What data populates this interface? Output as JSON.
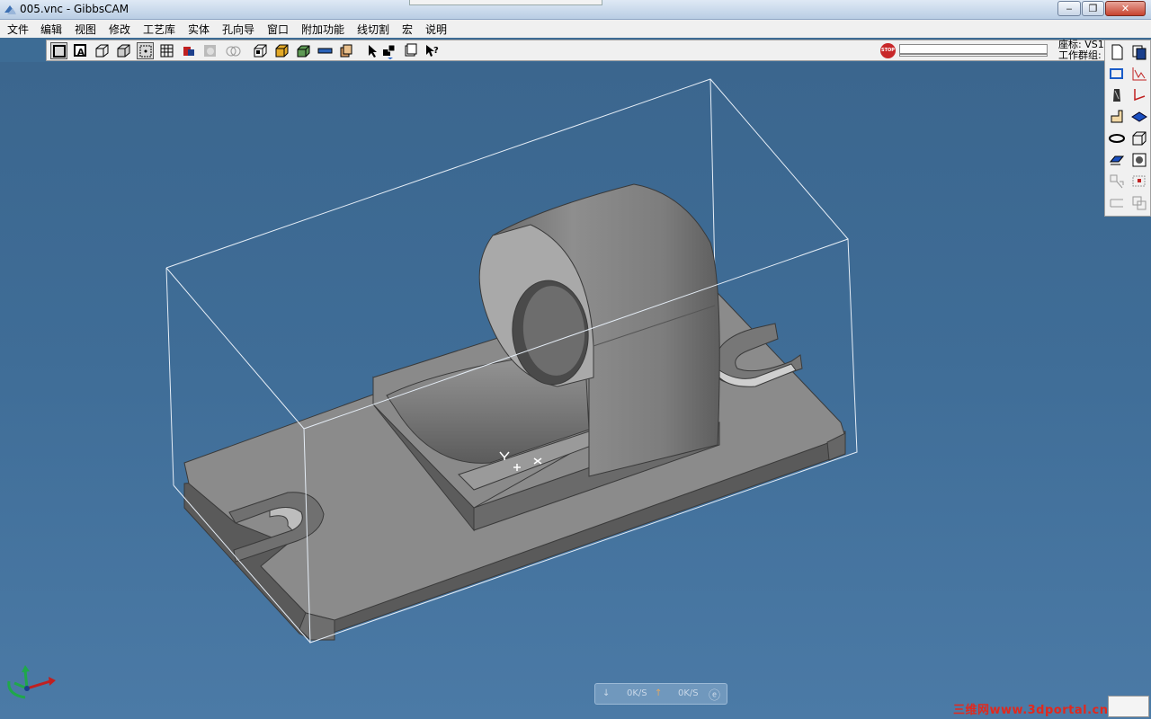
{
  "window": {
    "title": "005.vnc - GibbsCAM",
    "buttons": {
      "minimize": "‒",
      "maximize": "❐",
      "close": "✕"
    }
  },
  "menu": [
    "文件",
    "编辑",
    "视图",
    "修改",
    "工艺库",
    "实体",
    "孔向导",
    "窗口",
    "附加功能",
    "线切割",
    "宏",
    "说明"
  ],
  "toolbar": {
    "stop_label": "STOP",
    "coord_label": "座标: VS1",
    "group_label": "工作群组: "
  },
  "status": {
    "down_rate": "0K/S",
    "up_rate": "0K/S"
  },
  "watermark": "三维网www.3dportal.cn",
  "colors": {
    "viewport": "#3f6d97",
    "part": "#8a8a8a",
    "menubar": "#f0f0f0"
  }
}
